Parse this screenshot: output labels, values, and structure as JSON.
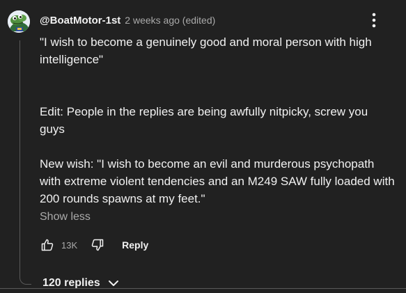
{
  "comment": {
    "author": "@BoatMotor-1st",
    "timestamp": "2 weeks ago (edited)",
    "avatar_icon": "frog-avatar-icon",
    "paragraphs": [
      "\"I wish to become a genuinely good and moral person with high intelligence\"",
      "Edit: People in the replies are being awfully nitpicky, screw you guys",
      "New wish: \"I wish to become an evil and murderous psychopath with extreme violent tendencies and an M249 SAW fully loaded with 200 rounds spawns at my feet.\""
    ],
    "show_less_label": "Show less",
    "like_count": "13K",
    "reply_label": "Reply",
    "replies_label": "120 replies"
  },
  "theme": {
    "background": "#212121",
    "primary_text": "#f1f1f1",
    "secondary_text": "#aaaaaa"
  }
}
